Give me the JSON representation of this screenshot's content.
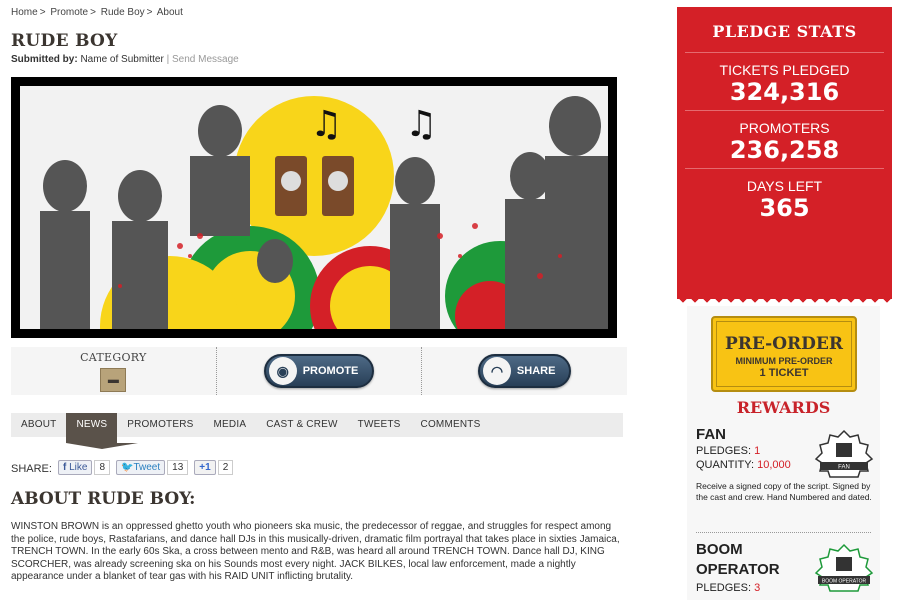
{
  "breadcrumb": [
    "Home",
    "Promote",
    "Rude Boy",
    "About"
  ],
  "breadcrumb_sep": ">",
  "title": "RUDE BOY",
  "submitted": {
    "label": "Submitted by:",
    "name": "Name of Submitter",
    "send": "| Send Message"
  },
  "action_bar": {
    "category_label": "CATEGORY",
    "promote_label": "PROMOTE",
    "share_label": "SHARE"
  },
  "tabs": [
    "ABOUT",
    "NEWS",
    "PROMOTERS",
    "MEDIA",
    "CAST & CREW",
    "TWEETS",
    "COMMENTS"
  ],
  "active_tab": "NEWS",
  "share": {
    "label": "SHARE:",
    "like": "Like",
    "like_count": "8",
    "tweet": "Tweet",
    "tweet_count": "13",
    "plus": "+1",
    "plus_count": "2"
  },
  "about": {
    "title": "ABOUT RUDE BOY:",
    "body": "WINSTON BROWN is an oppressed ghetto youth who pioneers ska music, the predecessor of reggae, and struggles for respect among the police, rude boys, Rastafarians, and dance hall DJs in this musically-driven, dramatic film portrayal that takes place in sixties Jamaica, TRENCH TOWN. In the early 60s Ska, a cross between mento and R&B, was heard all around TRENCH TOWN. Dance hall DJ, KING SCORCHER, was already screening ska on his Sounds most every night. JACK BILKES, local law enforcement, made a nightly appearance under a blanket of tear gas with his RAID UNIT inflicting brutality."
  },
  "stats": {
    "title": "PLEDGE STATS",
    "items": [
      {
        "label": "TICKETS PLEDGED",
        "value": "324,316"
      },
      {
        "label": "PROMOTERS",
        "value": "236,258"
      },
      {
        "label": "DAYS LEFT",
        "value": "365"
      }
    ]
  },
  "preorder": {
    "line1": "PRE-ORDER",
    "line2": "MINIMUM PRE-ORDER",
    "line3": "1 TICKET"
  },
  "rewards": {
    "title": "REWARDS",
    "items": [
      {
        "name": "FAN",
        "pledges_label": "PLEDGES:",
        "pledges": "1",
        "quantity_label": "QUANTITY:",
        "quantity": "10,000",
        "desc": "Receive a signed copy of the script. Signed by the cast and crew. Hand Numbered and dated.",
        "badge_text": "FAN"
      },
      {
        "name": "BOOM OPERATOR",
        "pledges_label": "PLEDGES:",
        "pledges": "3",
        "badge_text": "BOOM OPERATOR"
      }
    ]
  },
  "colors": {
    "brand_red": "#d42027",
    "dark_brown": "#3b3530",
    "gold": "#f8c314",
    "button_navy": "#283f57"
  }
}
